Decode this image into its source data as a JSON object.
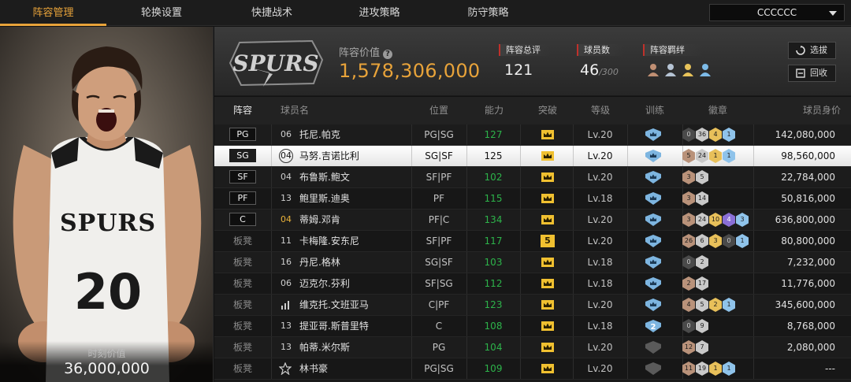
{
  "nav": {
    "tabs": [
      {
        "label": "阵容管理",
        "active": true
      },
      {
        "label": "轮换设置",
        "active": false
      },
      {
        "label": "快捷战术",
        "active": false
      },
      {
        "label": "进攻策略",
        "active": false
      },
      {
        "label": "防守策略",
        "active": false
      }
    ],
    "team_select": "CCCCCC"
  },
  "player_card": {
    "jersey_text": "SPURS",
    "jersey_number": "20",
    "value_label": "时刻价值",
    "value": "36,000,000"
  },
  "header": {
    "logo_text": "SPURS",
    "lineup_value_label": "阵容价值",
    "lineup_value": "1,578,306,000",
    "overall_label": "阵容总评",
    "overall": "121",
    "count_label": "球员数",
    "count": "46",
    "count_max": "/300",
    "bond_label": "阵容羁绊",
    "select_btn": "选拔",
    "recycle_btn": "回收"
  },
  "table": {
    "headers": [
      "阵容",
      "球员名",
      "位置",
      "能力",
      "突破",
      "等级",
      "训练",
      "徽章",
      "球员身价"
    ],
    "rows": [
      {
        "slot": "PG",
        "num": "06",
        "name": "托尼.帕克",
        "pos": "PG|SG",
        "power": "127",
        "break": "crown",
        "level": "Lv.20",
        "train": "crown",
        "badges": [
          {
            "c": "dark",
            "v": "0"
          },
          {
            "c": "silver",
            "v": "36"
          },
          {
            "c": "gold",
            "v": "4"
          },
          {
            "c": "blue",
            "v": "1"
          }
        ],
        "salary": "142,080,000"
      },
      {
        "slot": "SG",
        "num": "04",
        "name": "马努.吉诺比利",
        "pos": "SG|SF",
        "power": "125",
        "break": "crown",
        "level": "Lv.20",
        "train": "crown",
        "badges": [
          {
            "c": "bronze",
            "v": "5"
          },
          {
            "c": "silver",
            "v": "24"
          },
          {
            "c": "gold",
            "v": "1"
          },
          {
            "c": "blue",
            "v": "1"
          }
        ],
        "salary": "98,560,000",
        "selected": true
      },
      {
        "slot": "SF",
        "num": "04",
        "name": "布鲁斯.鲍文",
        "pos": "SF|PF",
        "power": "102",
        "break": "crown",
        "level": "Lv.20",
        "train": "crown",
        "badges": [
          {
            "c": "bronze",
            "v": "3"
          },
          {
            "c": "silver",
            "v": "5"
          }
        ],
        "salary": "22,784,000"
      },
      {
        "slot": "PF",
        "num": "13",
        "name": "鲍里斯.迪奥",
        "pos": "PF",
        "power": "115",
        "break": "crown",
        "level": "Lv.18",
        "train": "crown",
        "badges": [
          {
            "c": "bronze",
            "v": "3"
          },
          {
            "c": "silver",
            "v": "14"
          }
        ],
        "salary": "50,816,000"
      },
      {
        "slot": "C",
        "num": "04",
        "numGold": true,
        "name": "蒂姆.邓肯",
        "pos": "PF|C",
        "power": "134",
        "break": "crown",
        "level": "Lv.20",
        "train": "crown",
        "badges": [
          {
            "c": "bronze",
            "v": "3"
          },
          {
            "c": "silver",
            "v": "24"
          },
          {
            "c": "gold",
            "v": "10"
          },
          {
            "c": "purple",
            "v": "4"
          },
          {
            "c": "blue",
            "v": "3"
          }
        ],
        "salary": "636,800,000"
      },
      {
        "slot": "板凳",
        "num": "11",
        "name": "卡梅隆.安东尼",
        "pos": "SF|PF",
        "power": "117",
        "break": "5",
        "level": "Lv.20",
        "train": "crown",
        "badges": [
          {
            "c": "bronze",
            "v": "26"
          },
          {
            "c": "silver",
            "v": "6"
          },
          {
            "c": "gold",
            "v": "3"
          },
          {
            "c": "dark",
            "v": "0"
          },
          {
            "c": "blue",
            "v": "1"
          }
        ],
        "salary": "80,800,000"
      },
      {
        "slot": "板凳",
        "num": "16",
        "name": "丹尼.格林",
        "pos": "SG|SF",
        "power": "103",
        "break": "crown",
        "level": "Lv.18",
        "train": "crown",
        "badges": [
          {
            "c": "dark",
            "v": "0"
          },
          {
            "c": "silver",
            "v": "2"
          }
        ],
        "salary": "7,232,000"
      },
      {
        "slot": "板凳",
        "num": "06",
        "name": "迈克尔.芬利",
        "pos": "SF|SG",
        "power": "112",
        "break": "crown",
        "level": "Lv.18",
        "train": "crown",
        "badges": [
          {
            "c": "bronze",
            "v": "2"
          },
          {
            "c": "silver",
            "v": "17"
          }
        ],
        "salary": "11,776,000"
      },
      {
        "slot": "板凳",
        "num": "bars",
        "name": "维克托.文班亚马",
        "pos": "C|PF",
        "power": "123",
        "break": "crown",
        "level": "Lv.20",
        "train": "crown",
        "badges": [
          {
            "c": "bronze",
            "v": "4"
          },
          {
            "c": "silver",
            "v": "5"
          },
          {
            "c": "gold",
            "v": "2"
          },
          {
            "c": "blue",
            "v": "1"
          }
        ],
        "salary": "345,600,000"
      },
      {
        "slot": "板凳",
        "num": "13",
        "name": "提亚哥.斯普里特",
        "pos": "C",
        "power": "108",
        "break": "crown",
        "level": "Lv.18",
        "train": "2",
        "badges": [
          {
            "c": "dark",
            "v": "0"
          },
          {
            "c": "silver",
            "v": "9"
          }
        ],
        "salary": "8,768,000"
      },
      {
        "slot": "板凳",
        "num": "13",
        "name": "帕蒂.米尔斯",
        "pos": "PG",
        "power": "104",
        "break": "crown",
        "level": "Lv.20",
        "train": "gray",
        "badges": [
          {
            "c": "bronze",
            "v": "12"
          },
          {
            "c": "silver",
            "v": "7"
          }
        ],
        "salary": "2,080,000"
      },
      {
        "slot": "板凳",
        "num": "star",
        "name": "林书豪",
        "pos": "PG|SG",
        "power": "109",
        "break": "crown",
        "level": "Lv.20",
        "train": "gray",
        "badges": [
          {
            "c": "bronze",
            "v": "11"
          },
          {
            "c": "silver",
            "v": "19"
          },
          {
            "c": "gold",
            "v": "1"
          },
          {
            "c": "blue",
            "v": "1"
          }
        ],
        "salary": "---"
      }
    ]
  },
  "colors": {
    "accent": "#e8a33a",
    "power": "#2db34a",
    "red_marker": "#c0312b"
  }
}
